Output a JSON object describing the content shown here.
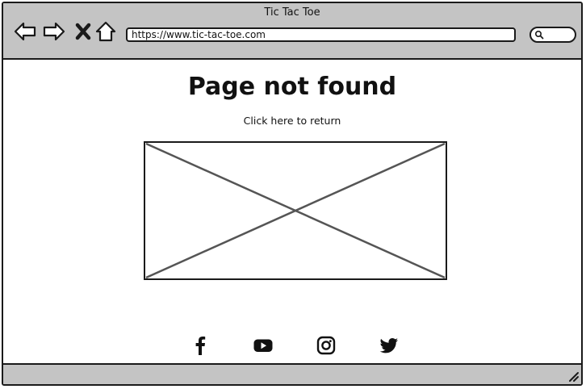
{
  "window": {
    "title": "Tic Tac Toe"
  },
  "browser": {
    "url": "https://www.tic-tac-toe.com",
    "nav_icons": [
      "back-arrow-icon",
      "forward-arrow-icon",
      "stop-icon",
      "home-icon"
    ],
    "search_icon": "search-icon"
  },
  "main": {
    "heading": "Page not found",
    "return_link": "Click here to return",
    "image_placeholder": "image-placeholder"
  },
  "social": {
    "icons": [
      "facebook-icon",
      "youtube-icon",
      "instagram-icon",
      "twitter-icon"
    ]
  },
  "colors": {
    "chrome_gray": "#c4c4c4",
    "ink": "#1a1a1a",
    "placeholder_cross": "#555555",
    "page_bg": "#ffffff"
  }
}
